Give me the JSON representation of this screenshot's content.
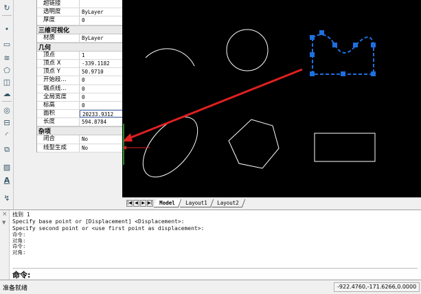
{
  "properties": {
    "rows_top": [
      {
        "label": "超链接",
        "value": ""
      },
      {
        "label": "透明度",
        "value": "ByLayer"
      },
      {
        "label": "厚度",
        "value": "0"
      }
    ],
    "cat_3d": "三维可视化",
    "rows_3d": [
      {
        "label": "材质",
        "value": "ByLayer"
      }
    ],
    "cat_geometry": "几何",
    "rows_geometry": [
      {
        "label": "顶点",
        "value": "1"
      },
      {
        "label": "顶点 X",
        "value": "-339.1182"
      },
      {
        "label": "顶点 Y",
        "value": "50.9710"
      },
      {
        "label": "开始段...",
        "value": "0"
      },
      {
        "label": "端点线...",
        "value": "0"
      },
      {
        "label": "全局宽度",
        "value": "0"
      },
      {
        "label": "标高",
        "value": "0"
      },
      {
        "label": "面积",
        "value": "20233.9312"
      },
      {
        "label": "长度",
        "value": "594.8784"
      }
    ],
    "cat_misc": "杂项",
    "rows_misc": [
      {
        "label": "闭合",
        "value": "No"
      },
      {
        "label": "线型生成",
        "value": "No"
      }
    ]
  },
  "layout_tabs": [
    {
      "label": "Model",
      "active": true
    },
    {
      "label": "Layout1",
      "active": false
    },
    {
      "label": "Layout2",
      "active": false
    }
  ],
  "command": {
    "history": [
      "找到 1",
      "Specify base point or [Displacement] <Displacement>:",
      "Specify second point or <use first point as displacement>:"
    ],
    "history_small": [
      "命令:",
      "对角:",
      "命令:",
      "对角:"
    ],
    "prompt": "命令:",
    "input_value": ""
  },
  "status": {
    "text": "准备就绪",
    "coords": "-922.4760,-171.6266,0.0000"
  },
  "colors": {
    "canvas_bg": "#000000",
    "entity": "#ffffff",
    "selected": "#1e6fe0",
    "arrow": "#e02020"
  },
  "icons": [
    "rotate-icon",
    "point-icon",
    "rectangle-icon",
    "hatch-icon",
    "polygon-icon",
    "region-icon",
    "revcloud-icon",
    "circle-icon",
    "table-icon",
    "fillet-icon",
    "block-icon",
    "gradient-icon",
    "text-icon",
    "properties-icon"
  ]
}
